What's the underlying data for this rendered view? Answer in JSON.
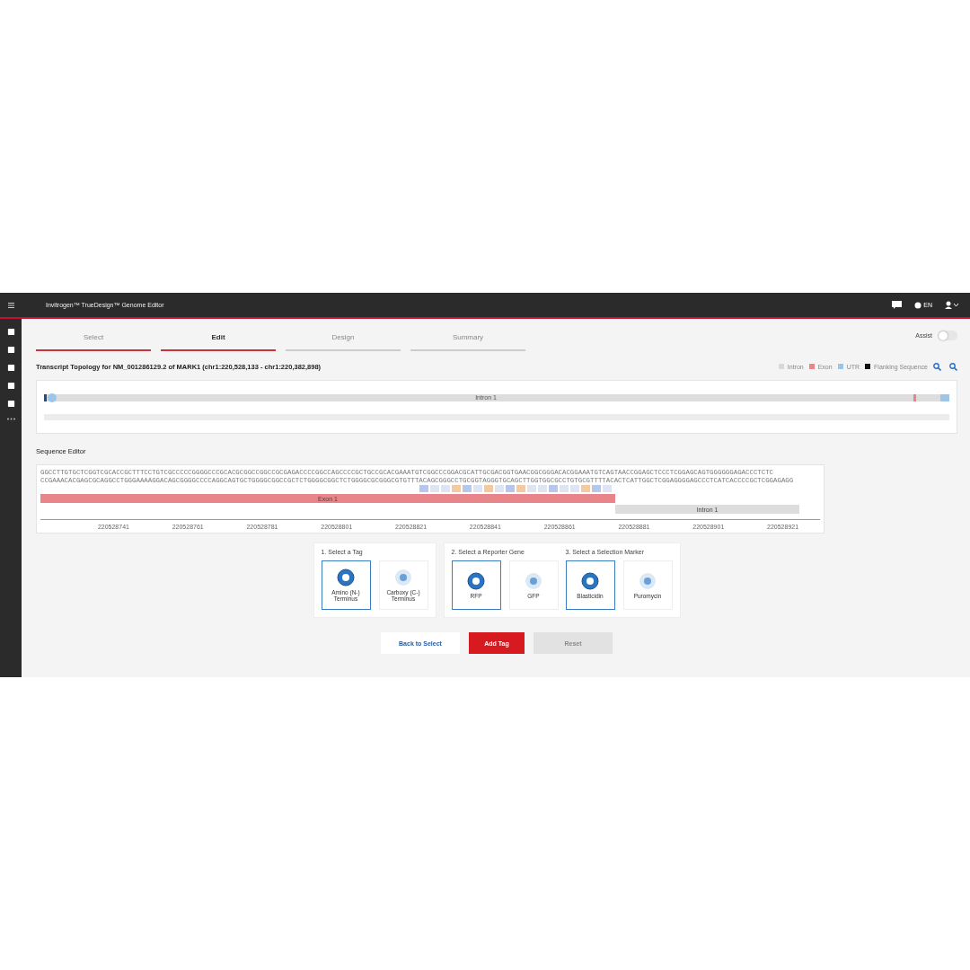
{
  "app_bar": {
    "title": "Invitrogen™ TrueDesign™ Genome Editor",
    "language": "EN"
  },
  "tabs": [
    {
      "label": "Select",
      "selected": false,
      "completed": true
    },
    {
      "label": "Edit",
      "selected": true,
      "completed": true
    },
    {
      "label": "Design",
      "selected": false,
      "completed": false
    },
    {
      "label": "Summary",
      "selected": false,
      "completed": false
    }
  ],
  "assist": {
    "label": "Assist",
    "on": false
  },
  "topology": {
    "title": "Transcript Topology for NM_001286129.2 of MARK1 (chr1:220,528,133 - chr1:220,382,898)",
    "legend": [
      {
        "label": "Intron",
        "color": "#d9d9d9"
      },
      {
        "label": "Exon",
        "color": "#e8858a"
      },
      {
        "label": "UTR",
        "color": "#9ec5e6"
      },
      {
        "label": "Flanking Sequence",
        "color": "#111111"
      }
    ],
    "track_label": "Intron 1"
  },
  "sequence_editor": {
    "title": "Sequence Editor",
    "lines": [
      "GGCCTTGTGCTCGGTCGCACCGCTTTCCTGTCGCCCCCGGGGCCCGCACGCGGCCGGCCGCGAGACCCCGGCCAGCCCCGCTGCCGCACGAAATGTCGGCCCGGACGCATTGCGACGGTGAACGGCGGGACACGGAAATGTCAGTAACCGGAGCTCCCTCGGAGCAGTGGGGGGAGACCCTCTC",
      "CCGAAACACGAGCGCAGGCCTGGGAAAAGGACAGCGGGGCCCCAGGCAGTGCTGGGGCGGCCGCTCTGGGGCGGCTCTGGGGCGCGGGCGTGTTTACAGCGGGCCTGCGGTAGGGTGCAGCTTGGTGGCGCCTGTGCGTTTTACACTCATTGGCTCGGAGGGGAGCCCTCATCACCCCGCTCGGAGAGG"
    ],
    "features": [
      {
        "label": "Exon 1",
        "kind": "exon"
      },
      {
        "label": "Intron 1",
        "kind": "intron"
      }
    ],
    "positions": [
      "220528741",
      "220528761",
      "220528781",
      "220528801",
      "220528821",
      "220528841",
      "220528861",
      "220528881",
      "220528901",
      "220528921"
    ]
  },
  "sections": [
    {
      "title": "1. Select a Tag",
      "options": [
        {
          "label": "Amino (N-) Terminus",
          "selected": true
        },
        {
          "label": "Carboxy (C-) Terminus",
          "selected": false
        }
      ]
    },
    {
      "title": "2. Select a Reporter Gene",
      "options": [
        {
          "label": "RFP",
          "selected": true
        },
        {
          "label": "GFP",
          "selected": false
        }
      ]
    },
    {
      "title": "3. Select a Selection Marker",
      "options": [
        {
          "label": "Blasticidin",
          "selected": true
        },
        {
          "label": "Puromycin",
          "selected": false
        }
      ]
    }
  ],
  "buttons": [
    {
      "label": "Back to Select",
      "kind": "secondary",
      "disabled": false
    },
    {
      "label": "Add Tag",
      "kind": "primary",
      "disabled": false
    },
    {
      "label": "Reset",
      "kind": "secondary",
      "disabled": true
    }
  ]
}
